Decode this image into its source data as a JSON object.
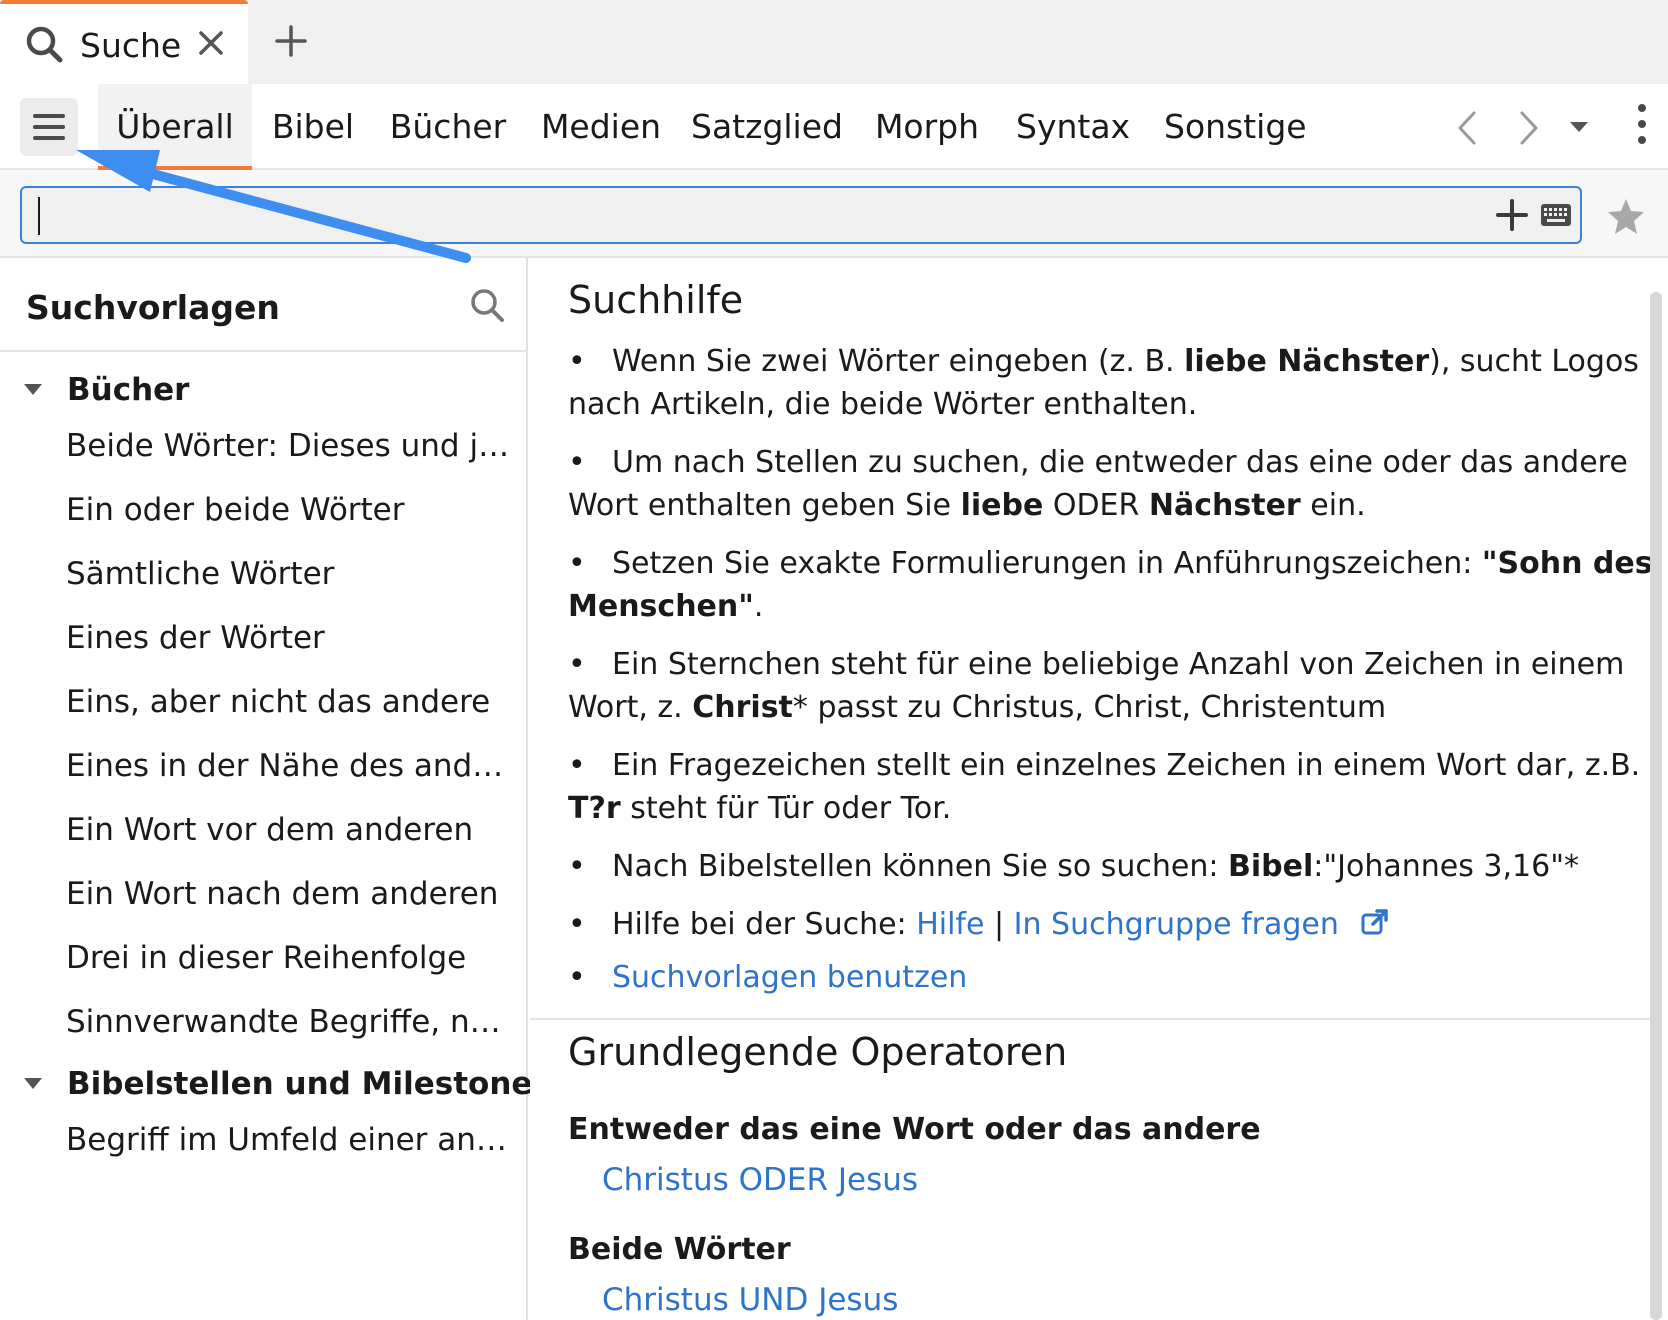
{
  "tab": {
    "label": "Suche",
    "icon": "search-icon"
  },
  "toolbar": {
    "tabs": [
      "Überall",
      "Bibel",
      "Bücher",
      "Medien",
      "Satzglied",
      "Morph",
      "Syntax",
      "Sonstige"
    ],
    "active_tab": "Überall"
  },
  "search": {
    "value": "",
    "placeholder": ""
  },
  "left_panel": {
    "title": "Suchvorlagen",
    "groups": [
      {
        "label": "Bücher",
        "items": [
          "Beide Wörter: Dieses und jenes",
          "Ein oder beide Wörter",
          "Sämtliche Wörter",
          "Eines der Wörter",
          "Eins, aber nicht das andere",
          "Eines in der Nähe des anderen",
          "Ein Wort vor dem anderen",
          "Ein Wort nach dem anderen",
          "Drei in dieser Reihenfolge",
          "Sinnverwandte Begriffe, nahe…"
        ]
      },
      {
        "label": "Bibelstellen und Milestones",
        "items": [
          "Begriff im Umfeld einer angef…"
        ]
      }
    ]
  },
  "help": {
    "title": "Suchhilfe",
    "b1": {
      "t1": "Wenn Sie zwei Wörter eingeben (z. B. ",
      "b1": "liebe Nächster",
      "t2": "), sucht Logos nach Artikeln, die beide Wörter enthalten."
    },
    "b2": {
      "t1": "Um nach Stellen zu suchen, die entweder das eine oder das andere Wort enthalten geben Sie ",
      "b1": "liebe",
      "t2": " ODER ",
      "b2": "Nächster",
      "t3": " ein."
    },
    "b3": {
      "t1": "Setzen Sie exakte Formulierungen in Anführungszeichen: ",
      "b1": "\"Sohn des Menschen\"",
      "t2": "."
    },
    "b4": {
      "t1": "Ein Sternchen steht für eine beliebige Anzahl von Zeichen in einem Wort, z. ",
      "b1": "Christ",
      "t2": "* passt zu Christus, Christ, Christentum"
    },
    "b5": {
      "t1": "Ein Fragezeichen stellt ein einzelnes Zeichen in einem Wort dar, z.B. ",
      "b1": "T?r",
      "t2": " steht für Tür oder Tor."
    },
    "b6": {
      "t1": "Nach Bibelstellen können Sie so suchen: ",
      "b1": "Bibel",
      "t2": ":\"Johannes 3,16\"*"
    },
    "b7": {
      "t1": "Hilfe bei der Suche: ",
      "link1": "Hilfe",
      "sep": " | ",
      "link2": "In Suchgruppe fragen"
    },
    "b8": {
      "link": "Suchvorlagen benutzen"
    }
  },
  "operators": {
    "title": "Grundlegende Operatoren",
    "sections": [
      {
        "heading": "Entweder das eine Wort oder das andere",
        "example": "Christus ODER Jesus"
      },
      {
        "heading": "Beide Wörter",
        "example": "Christus UND Jesus"
      }
    ]
  },
  "colors": {
    "accent": "#f07b3a",
    "link": "#2f74c9",
    "focus": "#3b82d9",
    "annotation_arrow": "#3d8ef0"
  }
}
